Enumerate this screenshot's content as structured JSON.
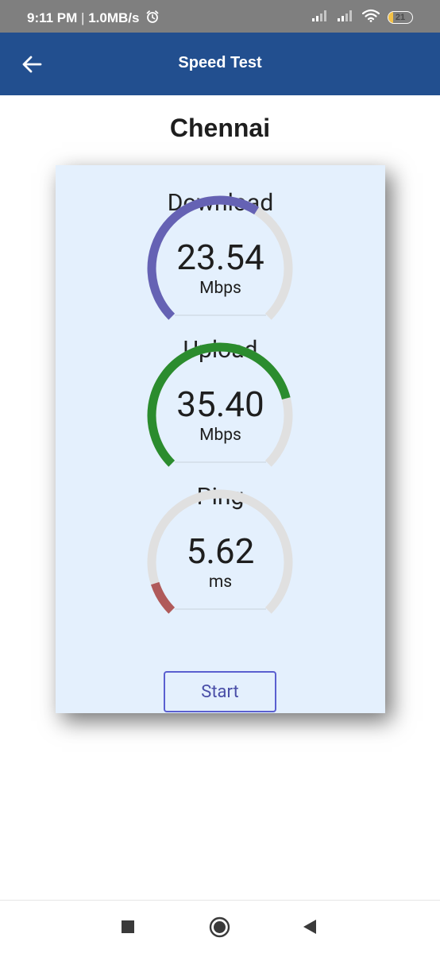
{
  "status_bar": {
    "time": "9:11 PM",
    "separator": "|",
    "speed": "1.0MB/s",
    "battery_level": "21",
    "battery_percent": 21
  },
  "app_bar": {
    "title": "Speed Test"
  },
  "city": "Chennai",
  "gauges": [
    {
      "label": "Download",
      "value": "23.54",
      "unit": "Mbps",
      "fraction": 0.62,
      "color": "#6562b4"
    },
    {
      "label": "Upload",
      "value": "35.40",
      "unit": "Mbps",
      "fraction": 0.78,
      "color": "#2b8c2e"
    },
    {
      "label": "Ping",
      "value": "5.62",
      "unit": "ms",
      "fraction": 0.1,
      "color": "#b05a5a"
    }
  ],
  "colors": {
    "track": "#e0e0e0",
    "app_bar": "#224f8f",
    "card": "#e4f0fd",
    "start_border": "#5a5fd0"
  },
  "start_button": {
    "label": "Start"
  },
  "nav": {
    "recents_icon": "square-icon",
    "home_icon": "circle-icon",
    "back_icon": "triangle-back-icon"
  }
}
